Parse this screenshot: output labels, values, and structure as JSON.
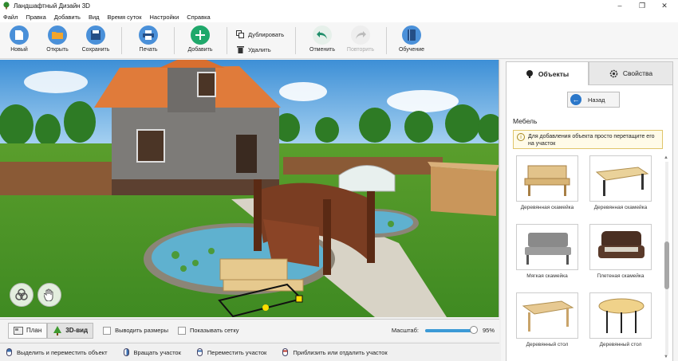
{
  "window": {
    "title": "Ландшафтный Дизайн 3D",
    "controls": [
      "minimize-icon",
      "restore-icon",
      "close-icon"
    ]
  },
  "menu": {
    "items": [
      "Файл",
      "Правка",
      "Добавить",
      "Вид",
      "Время суток",
      "Настройки",
      "Справка"
    ]
  },
  "toolbar": {
    "new_label": "Новый",
    "open_label": "Открыть",
    "save_label": "Сохранить",
    "print_label": "Печать",
    "add_label": "Добавить",
    "duplicate_label": "Дублировать",
    "delete_label": "Удалить",
    "undo_label": "Отменить",
    "redo_label": "Повторить",
    "learn_label": "Обучение"
  },
  "colors": {
    "accent": "#3c9ad6",
    "add_green": "#1fa86b",
    "folder": "#f3a52a"
  },
  "viewbar": {
    "plan_label": "План",
    "view3d_label": "3D-вид",
    "show_sizes_label": "Выводить размеры",
    "show_grid_label": "Показывать сетку",
    "scale_label": "Масштаб:",
    "scale_value": "95%",
    "scale_fraction": 0.95
  },
  "status": {
    "items": [
      "Выделить и переместить объект",
      "Вращать участок",
      "Переместить участок",
      "Приблизить или отдалить участок"
    ]
  },
  "panel": {
    "tab_objects": "Объекты",
    "tab_properties": "Свойства",
    "back_label": "Назад",
    "section_title": "Мебель",
    "hint": "Для добавления объекта просто перетащите его на участок",
    "items": [
      "Деревянная скамейка",
      "Деревянная скамейка",
      "Мягкая скамейка",
      "Плетеная скамейка",
      "Деревянный стол",
      "Деревянный стол"
    ]
  }
}
